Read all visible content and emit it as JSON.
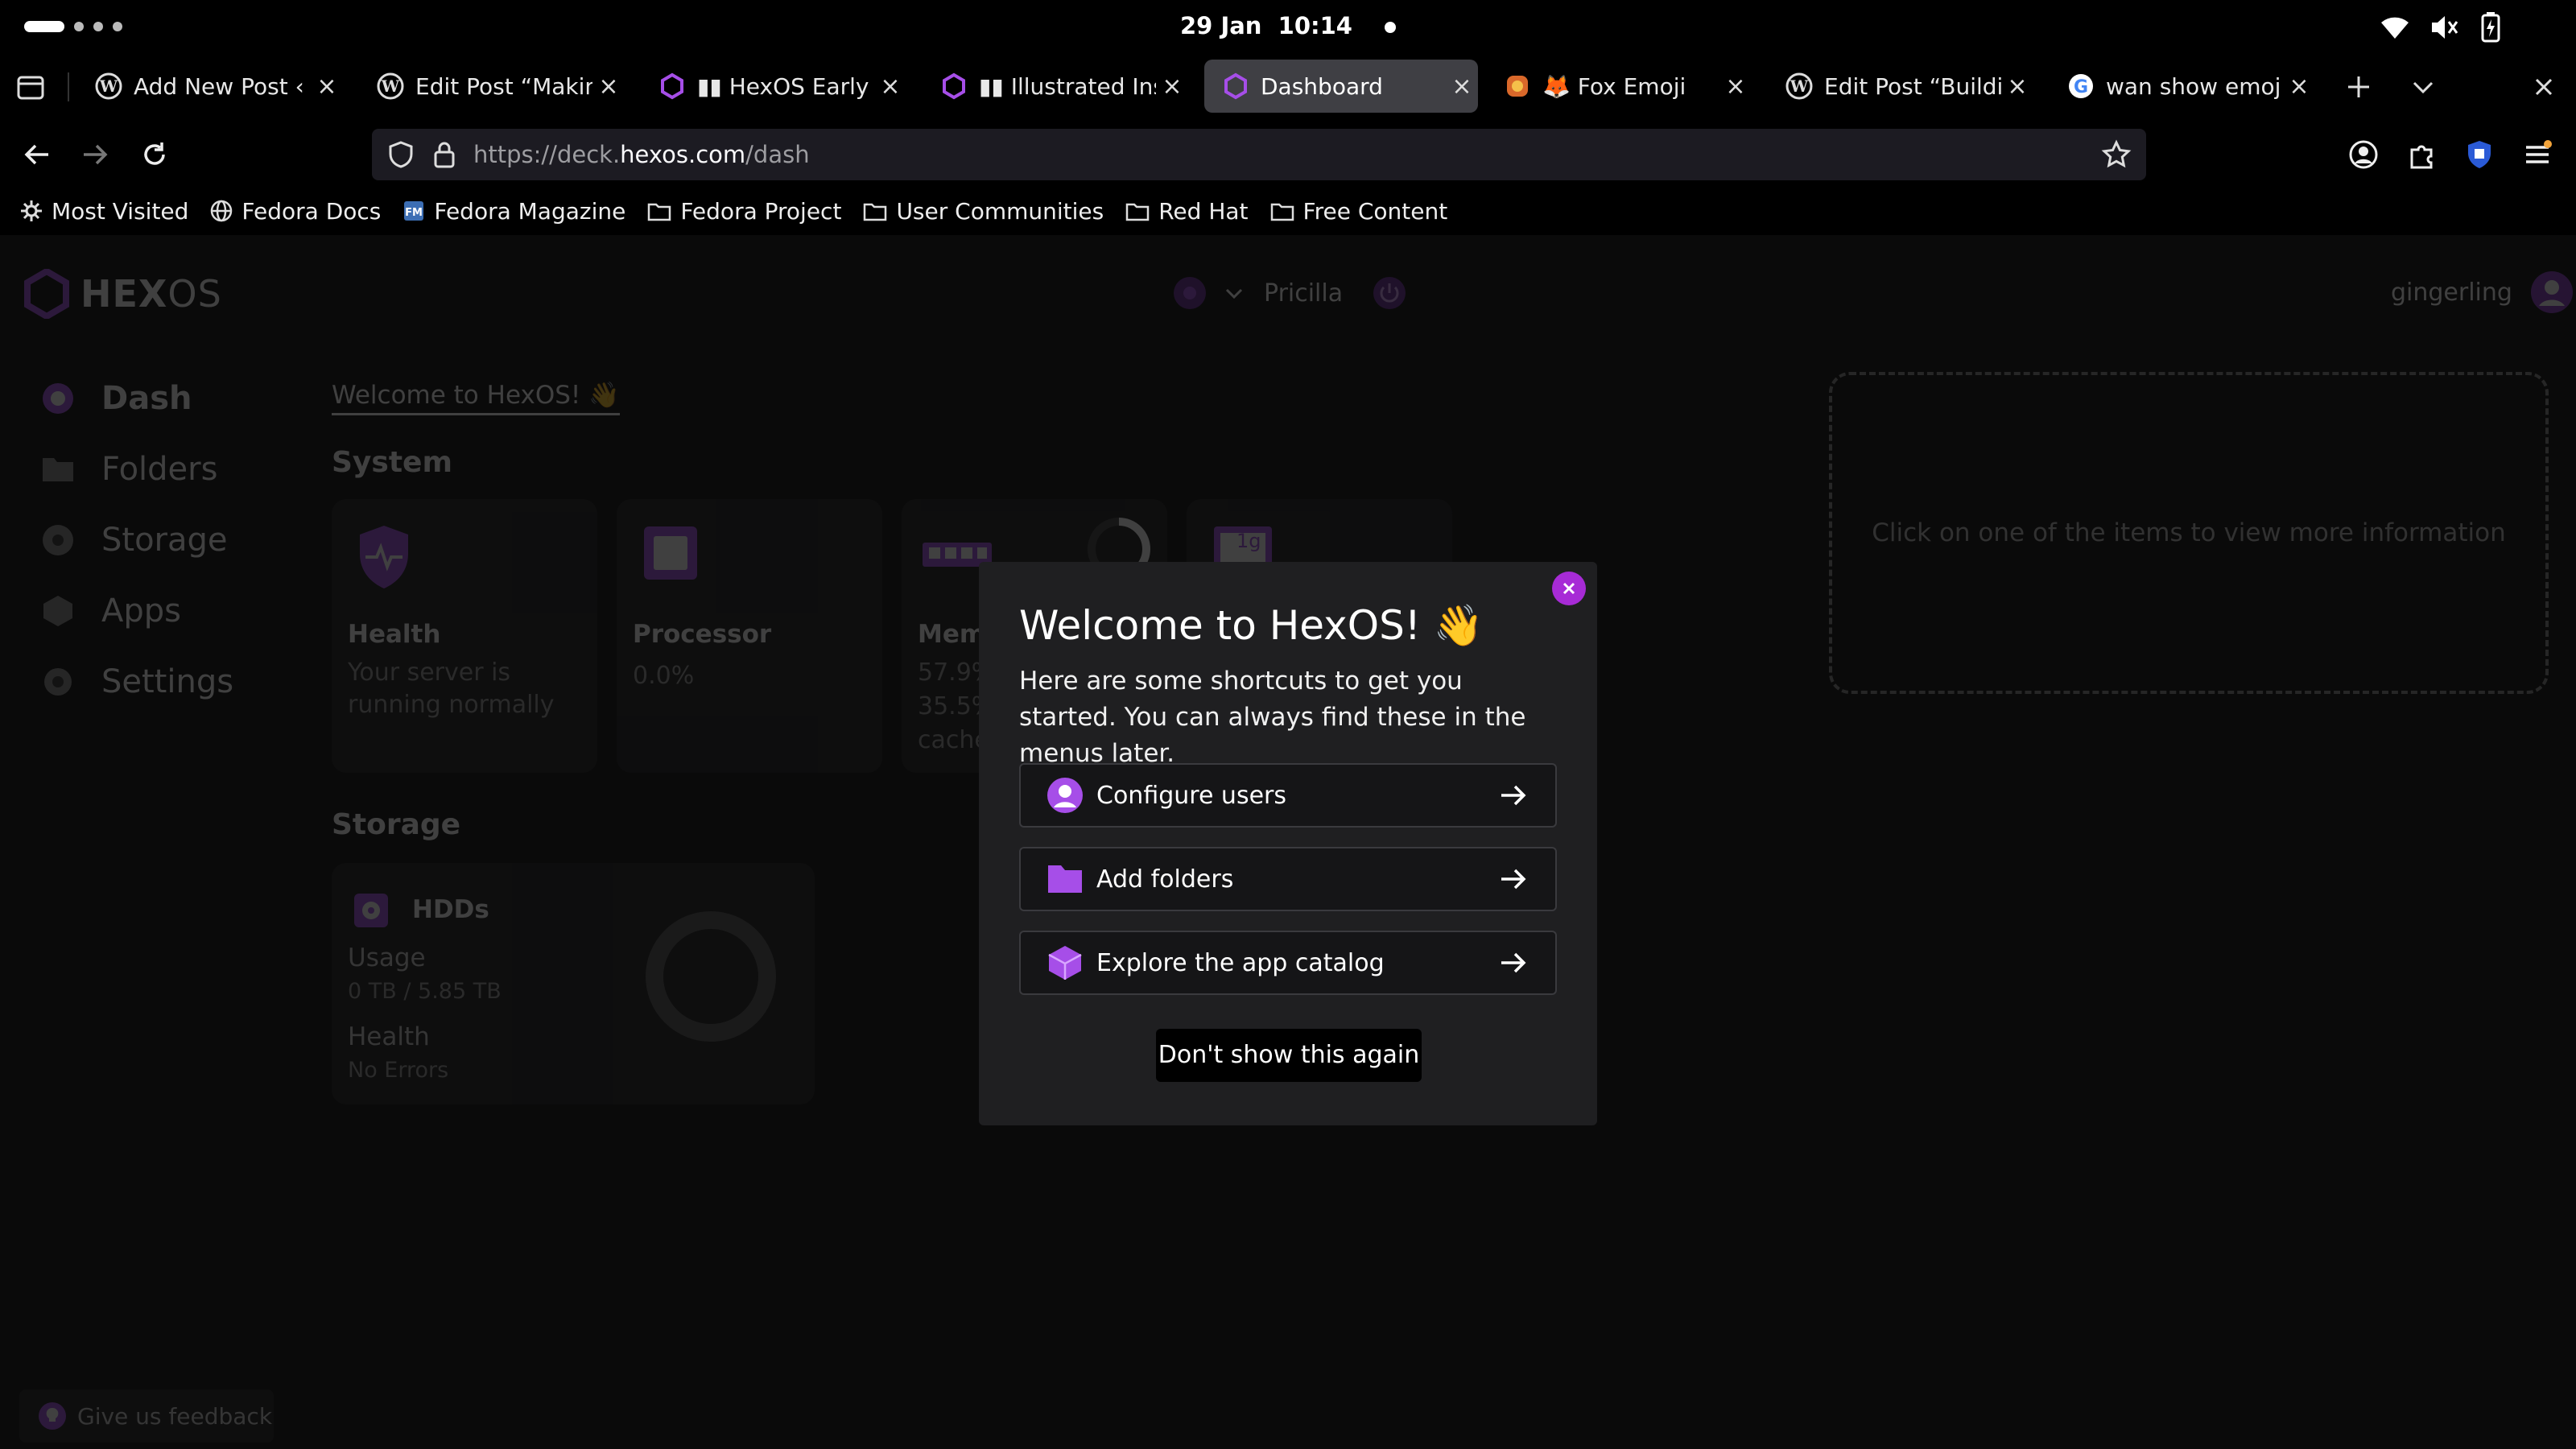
{
  "system_bar": {
    "date": "29 Jan",
    "time": "10:14"
  },
  "tabs": [
    {
      "title": "Add New Post ‹ A",
      "icon": "wordpress-icon"
    },
    {
      "title": "Edit Post “Making",
      "icon": "wordpress-icon"
    },
    {
      "title": "▮▮ HexOS Early A",
      "icon": "hexos-icon"
    },
    {
      "title": "▮▮ Illustrated Inst",
      "icon": "hexos-icon"
    },
    {
      "title": "Dashboard",
      "icon": "hexos-icon",
      "active": true
    },
    {
      "title": "🦊 Fox Emoji",
      "icon": "emoji-icon"
    },
    {
      "title": "Edit Post “Buildin",
      "icon": "wordpress-icon"
    },
    {
      "title": "wan show emoji",
      "icon": "google-icon"
    }
  ],
  "url": {
    "prefix": "https://deck.",
    "host": "hexos.com",
    "path": "/dash"
  },
  "bookmarks": [
    "Most Visited",
    "Fedora Docs",
    "Fedora Magazine",
    "Fedora Project",
    "User Communities",
    "Red Hat",
    "Free Content"
  ],
  "app": {
    "logo": {
      "hex": "HEX",
      "os": "OS"
    },
    "server_name": "Pricilla",
    "username": "gingerling",
    "sidebar": [
      {
        "label": "Dash",
        "icon": "dash-icon"
      },
      {
        "label": "Folders",
        "icon": "folder-icon"
      },
      {
        "label": "Storage",
        "icon": "storage-icon"
      },
      {
        "label": "Apps",
        "icon": "apps-icon"
      },
      {
        "label": "Settings",
        "icon": "gear-icon"
      }
    ],
    "welcome_link": "Welcome to HexOS! 👋",
    "system_heading": "System",
    "cards": {
      "health": {
        "label": "Health",
        "text": "Your server is running normally"
      },
      "processor": {
        "label": "Processor",
        "value": "0.0%"
      },
      "memory": {
        "label": "Mem",
        "lines": [
          "57.9%",
          "35.5%",
          "cache"
        ],
        "usage_fraction": 0.579
      },
      "fourth": {
        "chip": "1g"
      }
    },
    "storage_heading": "Storage",
    "hdds": {
      "label": "HDDs",
      "usage_label": "Usage",
      "usage_value": "0 TB / 5.85 TB",
      "health_label": "Health",
      "health_value": "No Errors"
    },
    "info_panel": "Click on one of the items to view more information",
    "feedback": "Give us feedback"
  },
  "modal": {
    "title": "Welcome to HexOS! 👋",
    "description": "Here are some shortcuts to get you started. You can always find these in the menus later.",
    "buttons": [
      {
        "label": "Configure users",
        "icon": "user-icon"
      },
      {
        "label": "Add folders",
        "icon": "folder-icon"
      },
      {
        "label": "Explore the app catalog",
        "icon": "cube-icon"
      }
    ],
    "dont_show": "Don't show this again"
  },
  "colors": {
    "accent": "#a72bd6",
    "background": "#0a0a0a",
    "card": "#1d1d1f"
  }
}
